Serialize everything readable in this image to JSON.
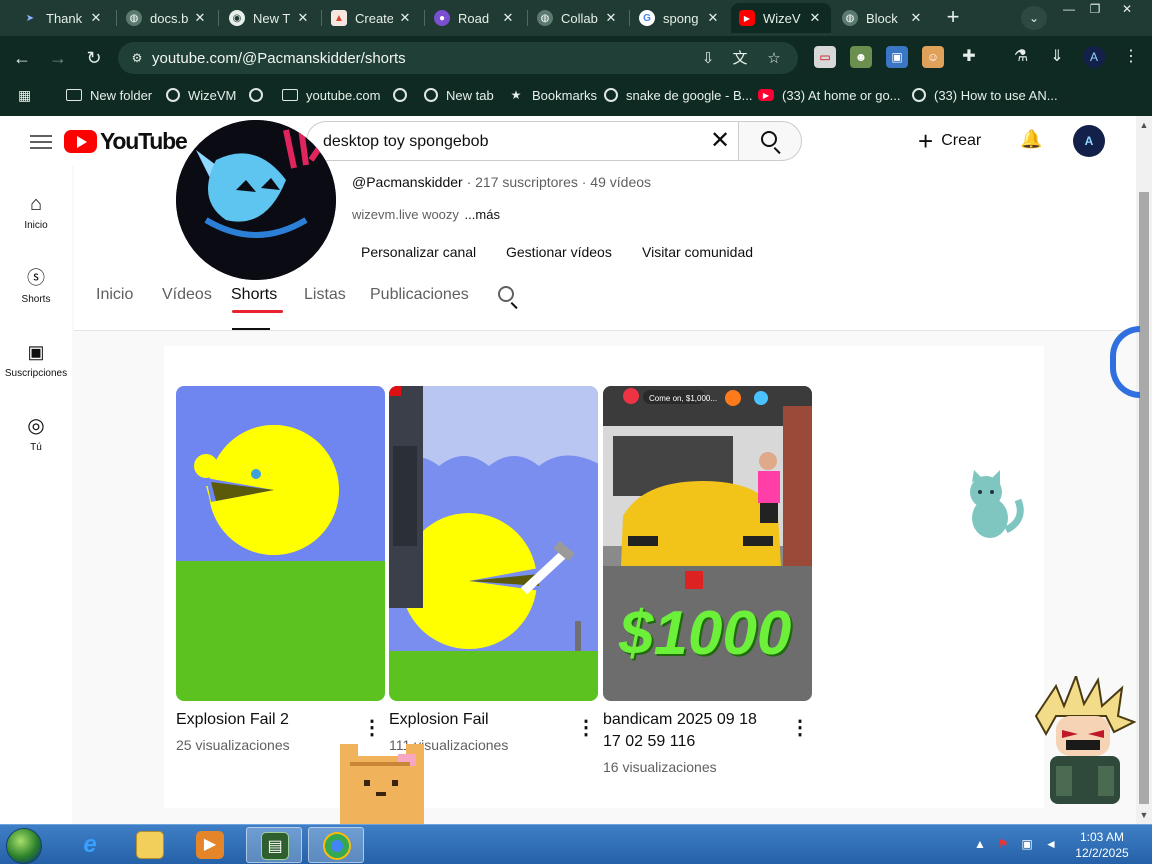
{
  "browser": {
    "tabs": [
      {
        "label": "Thank",
        "favicon": "twitter-icon",
        "active": false
      },
      {
        "label": "docs.b",
        "favicon": "globe-icon",
        "active": false
      },
      {
        "label": "New T",
        "favicon": "chrome-icon",
        "active": false
      },
      {
        "label": "Create",
        "favicon": "create-icon",
        "active": false
      },
      {
        "label": "Road",
        "favicon": "purple-icon",
        "active": false
      },
      {
        "label": "Collab",
        "favicon": "globe-icon",
        "active": false
      },
      {
        "label": "spong",
        "favicon": "google-icon",
        "active": false
      },
      {
        "label": "WizeV",
        "favicon": "youtube-icon",
        "active": true
      },
      {
        "label": "Block",
        "favicon": "globe-icon",
        "active": false
      }
    ],
    "url": "youtube.com/@Pacmanskidder/shorts",
    "bookmarks": [
      {
        "label": "New folder",
        "icon": "folder-icon"
      },
      {
        "label": "WizeVM",
        "icon": "globe-icon"
      },
      {
        "label": "",
        "icon": "globe-icon"
      },
      {
        "label": "youtube.com",
        "icon": "folder-icon"
      },
      {
        "label": "",
        "icon": "globe-icon"
      },
      {
        "label": "New tab",
        "icon": "globe-icon"
      },
      {
        "label": "Bookmarks",
        "icon": "star-icon"
      },
      {
        "label": "snake de google - B...",
        "icon": "globe-icon"
      },
      {
        "label": "(33) At home or go...",
        "icon": "youtube-icon"
      },
      {
        "label": "(33) How to use AN...",
        "icon": "globe-icon"
      }
    ]
  },
  "youtube": {
    "logo_text": "YouTube",
    "search_query": "desktop toy spongebob",
    "create_label": "Crear",
    "avatar_letters": "A",
    "guide": [
      {
        "label": "Inicio",
        "icon": "home-icon"
      },
      {
        "label": "Shorts",
        "icon": "shorts-icon"
      },
      {
        "label": "Suscripciones",
        "icon": "subscriptions-icon"
      },
      {
        "label": "Tú",
        "icon": "you-icon"
      }
    ],
    "channel": {
      "handle": "@Pacmanskidder",
      "stats": " · 217 suscriptores · 49 vídeos",
      "description": "wizevm.live woozy",
      "more": "...más",
      "buttons": [
        "Personalizar canal",
        "Gestionar vídeos",
        "Visitar comunidad"
      ],
      "tabs": [
        "Inicio",
        "Vídeos",
        "Shorts",
        "Listas",
        "Publicaciones"
      ],
      "active_tab": "Shorts"
    },
    "shorts": [
      {
        "title": "Explosion Fail 2",
        "views": "25 visualizaciones"
      },
      {
        "title": "Explosion Fail",
        "views": "111 visualizaciones"
      },
      {
        "title": "bandicam 2025 09 18 17 02 59 116",
        "views": "16 visualizaciones",
        "overlay_text": "$1000",
        "overlay_caption": "Come on, $1,000..."
      }
    ]
  },
  "taskbar": {
    "time": "1:03 AM",
    "date": "12/2/2025"
  },
  "colors": {
    "chrome_frame": "#1f3b33",
    "chrome_toolbar": "#0e2a22",
    "yt_red": "#ff0000",
    "tab_underline": "#e8222e",
    "taskbar": "#2561a8"
  }
}
